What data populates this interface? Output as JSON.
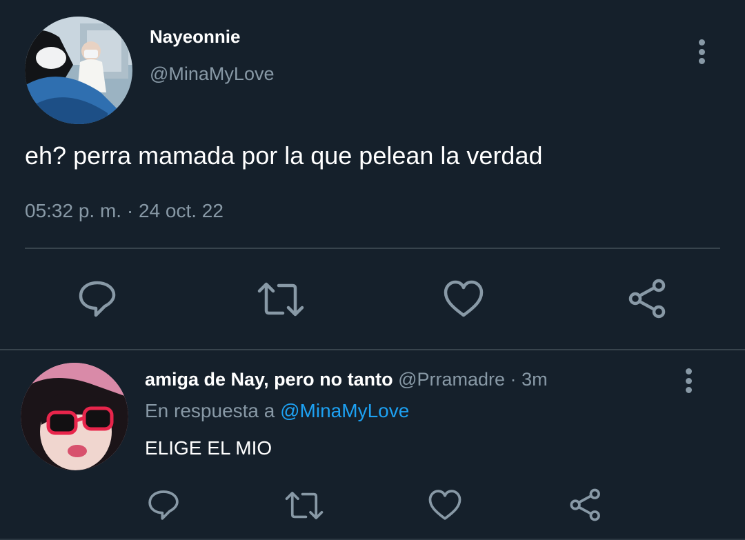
{
  "main_tweet": {
    "author_name": "Nayeonnie",
    "author_handle": "@MinaMyLove",
    "text": "eh? perra mamada por la que pelean la verdad",
    "timestamp": "05:32 p. m. · 24 oct. 22",
    "actions": [
      "reply-icon",
      "retweet-icon",
      "like-icon",
      "share-icon"
    ]
  },
  "reply": {
    "author_name": "amiga de Nay, pero no tanto",
    "author_handle": "@Prramadre",
    "separator": "·",
    "time": "3m",
    "replying_prefix": "En respuesta a",
    "replying_to": "@MinaMyLove",
    "text": "ELIGE EL MIO",
    "actions": [
      "reply-icon",
      "retweet-icon",
      "like-icon",
      "share-icon"
    ]
  },
  "colors": {
    "background": "#15202b",
    "primary_text": "#ffffff",
    "secondary_text": "#8899a6",
    "link": "#1da1f2",
    "divider": "#38444d"
  }
}
